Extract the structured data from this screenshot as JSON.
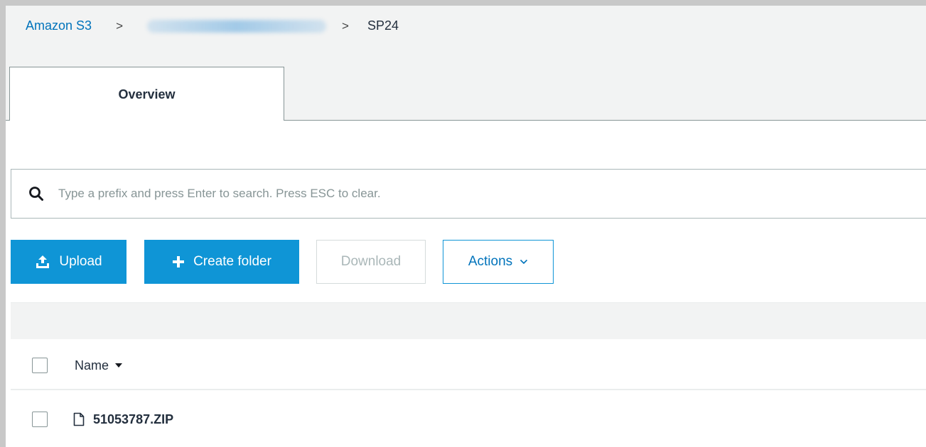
{
  "breadcrumb": {
    "root": "Amazon S3",
    "separator": ">",
    "current": "SP24"
  },
  "tabs": [
    {
      "label": "Overview",
      "active": true
    }
  ],
  "search": {
    "placeholder": "Type a prefix and press Enter to search. Press ESC to clear.",
    "value": "",
    "icon": "search-icon"
  },
  "toolbar": {
    "upload_label": "Upload",
    "upload_icon": "upload-icon",
    "create_folder_label": "Create folder",
    "create_folder_icon": "plus-icon",
    "download_label": "Download",
    "actions_label": "Actions",
    "actions_icon": "chevron-down-icon"
  },
  "table": {
    "columns": [
      {
        "label": "Name",
        "sort": "descending"
      }
    ],
    "rows": [
      {
        "name": "51053787.ZIP",
        "icon": "file-icon"
      }
    ]
  },
  "colors": {
    "primary": "#0f95d6",
    "link": "#0073bb",
    "text": "#232f3e",
    "disabled": "#aab7b8"
  }
}
